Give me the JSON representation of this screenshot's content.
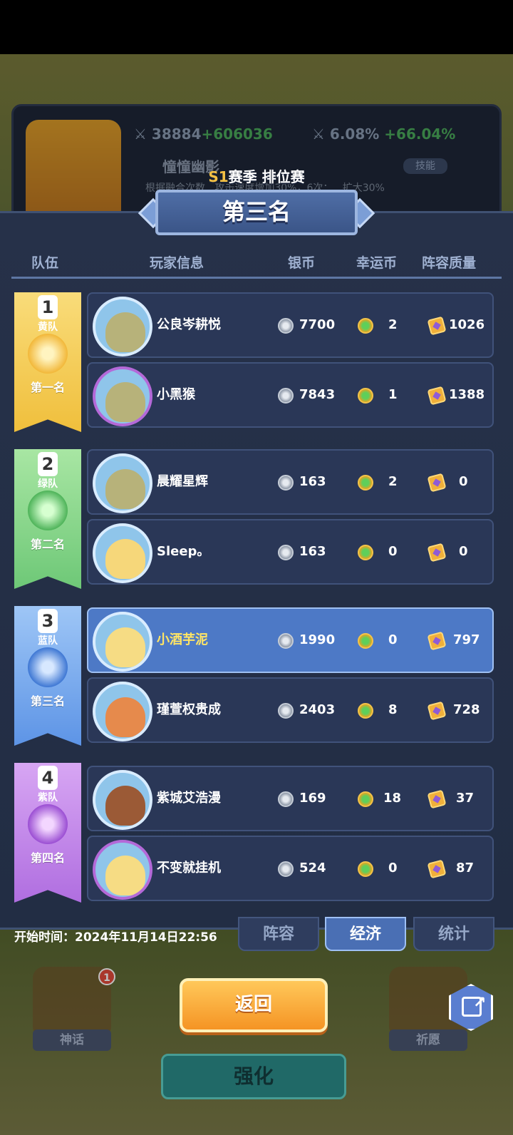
{
  "background": {
    "stat_attack": "38884",
    "stat_attack_bonus": "+606036",
    "stat_speed": "6.08%",
    "stat_speed_bonus": "+66.04%",
    "hero_name": "憧憧幽影",
    "skill_tab": "技能",
    "desc": "根据融合次数...攻击速度增加30%，6次：...扩大30%",
    "shrine_left": "神话",
    "shrine_right": "祈愿",
    "shrine_badge": "1",
    "strength_button": "强化"
  },
  "header": {
    "season_prefix": "S1",
    "season_text": "赛季 排位赛",
    "result_title": "第三名"
  },
  "columns": {
    "team": "队伍",
    "player_info": "玩家信息",
    "silver": "银币",
    "luck": "幸运币",
    "quality": "阵容质量"
  },
  "teams": [
    {
      "num": "1",
      "name": "黄队",
      "place": "第一名",
      "color": "#f4c445"
    },
    {
      "num": "2",
      "name": "绿队",
      "place": "第二名",
      "color": "#5cc46a"
    },
    {
      "num": "3",
      "name": "蓝队",
      "place": "第三名",
      "color": "#4e8ee8"
    },
    {
      "num": "4",
      "name": "紫队",
      "place": "第四名",
      "color": "#b36ee0"
    }
  ],
  "players": [
    {
      "name": "公良岑耕悦",
      "silver": "7700",
      "luck": "2",
      "quality": "1026"
    },
    {
      "name": "小黑猴",
      "silver": "7843",
      "luck": "1",
      "quality": "1388"
    },
    {
      "name": "晨耀星辉",
      "silver": "163",
      "luck": "2",
      "quality": "0"
    },
    {
      "name": "Sleep。",
      "silver": "163",
      "luck": "0",
      "quality": "0"
    },
    {
      "name": "小酒芋泥",
      "silver": "1990",
      "luck": "0",
      "quality": "797"
    },
    {
      "name": "瑾萱权贵成",
      "silver": "2403",
      "luck": "8",
      "quality": "728"
    },
    {
      "name": "紫城艾浩漫",
      "silver": "169",
      "luck": "18",
      "quality": "37"
    },
    {
      "name": "不变就挂机",
      "silver": "524",
      "luck": "0",
      "quality": "87"
    }
  ],
  "footer": {
    "start_time": "开始时间：2024年11月14日22:56",
    "tab_lineup": "阵容",
    "tab_economy": "经济",
    "tab_stats": "统计",
    "back_button": "返回"
  }
}
